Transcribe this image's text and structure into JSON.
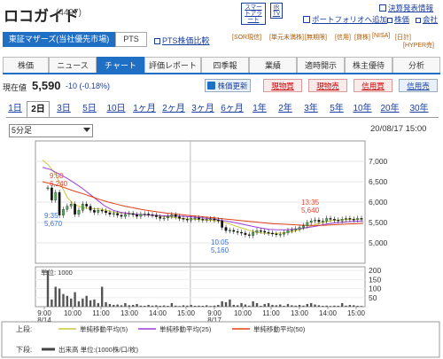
{
  "header": {
    "title": "ロコガイド",
    "code": "(4497)",
    "smart_alert": "スマートアラート",
    "ir_tv": "IR TV",
    "links": [
      "決算発表情報",
      "ポートフォリオへ追加",
      "株価",
      "会社"
    ]
  },
  "market": {
    "selected": "東証マザーズ(当社優先市場)",
    "pts": "PTS",
    "pts_compare": "PTS株価比較",
    "badges": [
      "[SOR現信]",
      "[単元未満株]",
      "[無期限]",
      "[信用]",
      "[貸株]",
      "[NISA]",
      "[日計]",
      "[HYPER売]"
    ]
  },
  "tabs": [
    {
      "label": "株価",
      "active": false
    },
    {
      "label": "ニュース",
      "active": false
    },
    {
      "label": "チャート",
      "active": true
    },
    {
      "label": "評価レポート",
      "active": false
    },
    {
      "label": "四季報",
      "active": false
    },
    {
      "label": "業績",
      "active": false
    },
    {
      "label": "適時開示",
      "active": false
    },
    {
      "label": "株主優待",
      "active": false
    },
    {
      "label": "分析",
      "active": false
    }
  ],
  "price": {
    "label": "現在値",
    "value": "5,590",
    "change": "-10 (-0.18%)",
    "refresh": "株価更新",
    "buttons": [
      "現物買",
      "現物売",
      "信用買",
      "信用売"
    ]
  },
  "period_tabs": [
    "1日",
    "2日",
    "3日",
    "5日",
    "10日",
    "1ヶ月",
    "2ヶ月",
    "3ヶ月",
    "6ヶ月",
    "1年",
    "2年",
    "3年",
    "5年",
    "10年",
    "20年",
    "30年"
  ],
  "period_active": "2日",
  "interval": "5分足",
  "datetime": "20/08/17 15:00",
  "chart_data": {
    "type": "line",
    "subtype": "candlestick-intraday",
    "period": "2日",
    "interval": "5分足",
    "datetime": "20/08/17 15:00",
    "price_ylim": [
      4500,
      7500
    ],
    "price_ticks": [
      "7,000",
      "6,500",
      "6,000",
      "5,500",
      "5,000"
    ],
    "price_tick_values": [
      7000,
      6500,
      6000,
      5500,
      5000
    ],
    "volume_ylim": [
      0,
      220
    ],
    "volume_ticks": [
      "200",
      "150",
      "100",
      "50"
    ],
    "volume_tick_values": [
      200,
      150,
      100,
      50
    ],
    "volume_unit_label": "単位: 1000",
    "x_ticks": [
      "9:00",
      "10:00",
      "11:00",
      "13:00",
      "14:00",
      "15:00",
      "9:00",
      "10:00",
      "11:00",
      "13:00",
      "14:00",
      "15:00"
    ],
    "x_tick_sublabels": [
      "8/14",
      "",
      "",
      "",
      "",
      "",
      "8/17",
      "",
      "",
      "",
      "",
      ""
    ],
    "annotations": [
      {
        "time": "9:50",
        "price": "6,240",
        "color": "#e8463a"
      },
      {
        "time": "9:35",
        "price": "5,670",
        "color": "#3a6fd8"
      },
      {
        "time": "10:05",
        "price": "5,160",
        "color": "#3a6fd8"
      },
      {
        "time": "13:35",
        "price": "5,640",
        "color": "#e8463a"
      }
    ],
    "candles": [
      6350,
      6050,
      6240,
      5680,
      5820,
      5900,
      5950,
      5700,
      5800,
      5950,
      5900,
      5800,
      5750,
      5800,
      5780,
      5740,
      5700,
      5720,
      5680,
      5650,
      5700,
      5720,
      5690,
      5650,
      5700,
      5710,
      5690,
      5680,
      5640,
      5600,
      5610,
      5650,
      5690,
      5640,
      5600,
      5580,
      5560,
      5600,
      5610,
      5580,
      5560,
      5580,
      5590,
      5560,
      5540,
      5380,
      5300,
      5310,
      5280,
      5260,
      5240,
      5200,
      5180,
      5260,
      5300,
      5290,
      5260,
      5240,
      5220,
      5200,
      5210,
      5250,
      5300,
      5320,
      5340,
      5380,
      5420,
      5500,
      5540,
      5560,
      5520,
      5540,
      5600,
      5580,
      5560,
      5540,
      5580,
      5600,
      5580,
      5570,
      5600,
      5590
    ],
    "volumes": [
      200,
      40,
      110,
      100,
      70,
      60,
      45,
      80,
      30,
      45,
      60,
      35,
      40,
      20,
      110,
      25,
      15,
      10,
      12,
      8,
      20,
      8,
      10,
      15,
      6,
      5,
      10,
      6,
      8,
      5,
      7,
      5,
      20,
      6,
      4,
      8,
      6,
      10,
      5,
      6,
      5,
      8,
      4,
      6,
      10,
      30,
      25,
      40,
      10,
      8,
      20,
      12,
      6,
      30,
      20,
      5,
      15,
      20,
      10,
      8,
      12,
      5,
      15,
      8,
      6,
      10,
      6,
      15,
      20,
      12,
      8,
      5,
      6,
      4,
      6,
      5,
      20,
      6,
      10,
      8,
      5,
      4
    ],
    "series": [
      {
        "name": "単純移動平均(5)",
        "color": "#c8c83c",
        "values": [
          7030,
          6900,
          6700,
          6400,
          6100,
          5950,
          5880,
          5850,
          5840,
          5830,
          5800,
          5760,
          5740,
          5730,
          5720,
          5700,
          5690,
          5680,
          5670,
          5650,
          5640,
          5620,
          5600,
          5590,
          5580,
          5570,
          5560,
          5550,
          5540,
          5500,
          5450,
          5400,
          5350,
          5300,
          5260,
          5240,
          5230,
          5230,
          5240,
          5260,
          5290,
          5330,
          5380,
          5430,
          5480,
          5520,
          5550,
          5560,
          5570,
          5580,
          5580,
          5590
        ]
      },
      {
        "name": "単純移動平均(25)",
        "color": "#9b3fdc",
        "values": [
          6850,
          6800,
          6700,
          6600,
          6480,
          6350,
          6200,
          6050,
          5900,
          5800,
          5750,
          5720,
          5700,
          5690,
          5680,
          5670,
          5660,
          5660,
          5650,
          5640,
          5620,
          5600,
          5580,
          5550,
          5520,
          5480,
          5440,
          5400,
          5360,
          5330,
          5320,
          5320,
          5330,
          5350,
          5380,
          5410,
          5450,
          5480,
          5500,
          5520,
          5530,
          5540
        ]
      },
      {
        "name": "単純移動平均(50)",
        "color": "#e0401a",
        "values": [
          6500,
          6450,
          6400,
          6330,
          6260,
          6200,
          6130,
          6060,
          6000,
          5950,
          5900,
          5860,
          5820,
          5790,
          5760,
          5730,
          5710,
          5690,
          5670,
          5650,
          5630,
          5610,
          5590,
          5570,
          5550,
          5530,
          5510,
          5490,
          5470,
          5460,
          5450,
          5440,
          5430,
          5430,
          5430,
          5440,
          5450,
          5460,
          5470,
          5480
        ]
      }
    ],
    "legend": {
      "upper_label": "上段:",
      "lower_label": "下段:",
      "volume_name": "出来高 単位:(1000株/口/枚)"
    }
  }
}
